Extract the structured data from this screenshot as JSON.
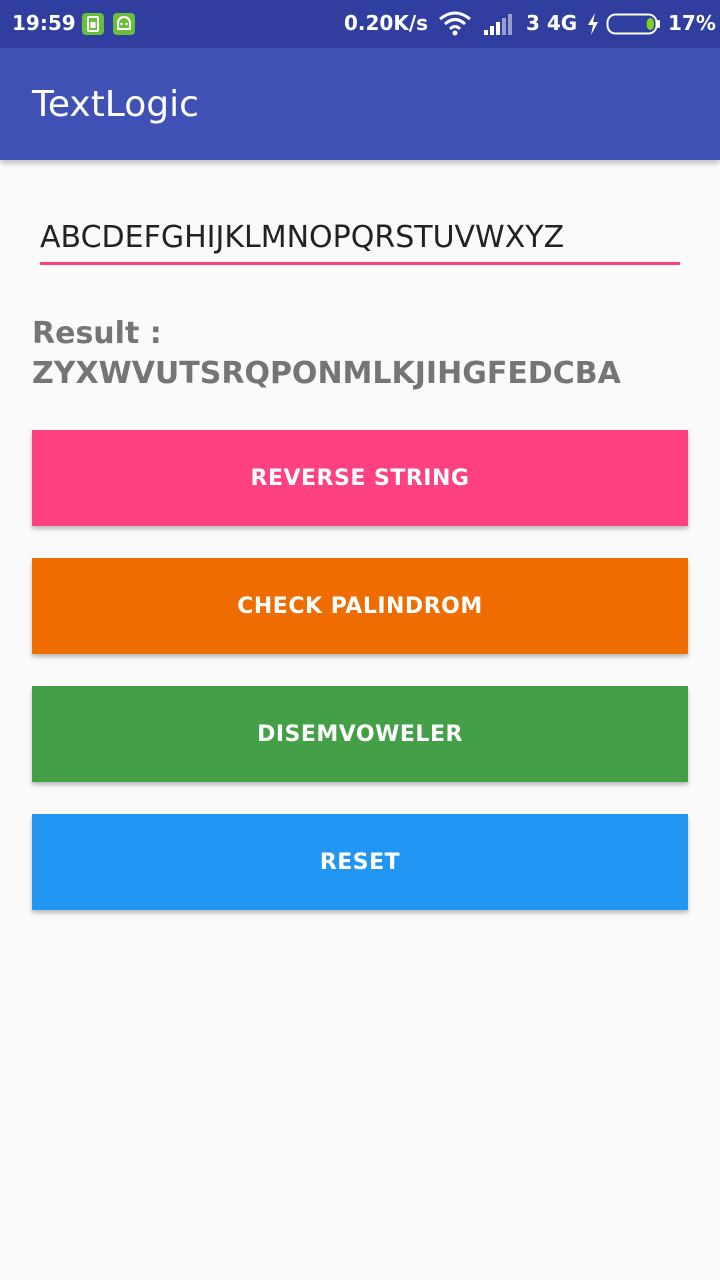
{
  "status_bar": {
    "time": "19:59",
    "speed": "0.20K/s",
    "network": "3 4G",
    "battery_percent": "17%",
    "battery_level": 0.17,
    "icons": [
      "sim-notification-icon",
      "android-notification-icon",
      "wifi-icon",
      "signal-icon",
      "charging-icon",
      "battery-icon"
    ]
  },
  "app_bar": {
    "title": "TextLogic",
    "color": "#3f51b5"
  },
  "input": {
    "value": "ABCDEFGHIJKLMNOPQRSTUVWXYZ",
    "underline_color": "#ff4081"
  },
  "result": {
    "label": "Result :",
    "value": "ZYXWVUTSRQPONMLKJIHGFEDCBA"
  },
  "buttons": {
    "reverse": {
      "label": "REVERSE STRING",
      "color": "#ff4081"
    },
    "palindrom": {
      "label": "CHECK PALINDROM",
      "color": "#ef6c00"
    },
    "disemvoweler": {
      "label": "DISEMVOWELER",
      "color": "#43a047"
    },
    "reset": {
      "label": "RESET",
      "color": "#2196f3"
    }
  }
}
